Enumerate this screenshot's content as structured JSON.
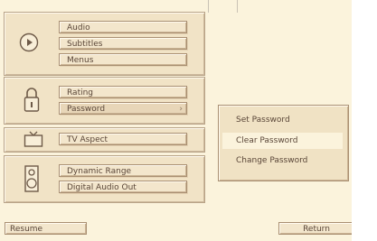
{
  "groups": {
    "audio": {
      "items": [
        "Audio",
        "Subtitles",
        "Menus"
      ]
    },
    "security": {
      "items": [
        "Rating",
        "Password"
      ]
    },
    "display": {
      "items": [
        "TV Aspect"
      ]
    },
    "sound": {
      "items": [
        "Dynamic Range",
        "Digital Audio Out"
      ]
    }
  },
  "password_menu": {
    "items": [
      "Set Password",
      "Clear Password",
      "Change Password"
    ],
    "active_index": 1
  },
  "footer": {
    "resume_label": "Resume",
    "return_label": "Return"
  },
  "icons": {
    "audio_group": "disc-play-icon",
    "security_group": "padlock-icon",
    "display_group": "tv-icon",
    "sound_group": "speaker-icon",
    "password_submenu": "chevron-right-icon"
  },
  "colors": {
    "background": "#fbf3dc",
    "panel": "#f1e3c6",
    "button": "#f3e6cc",
    "border": "#a98f72",
    "text": "#5a4638"
  }
}
